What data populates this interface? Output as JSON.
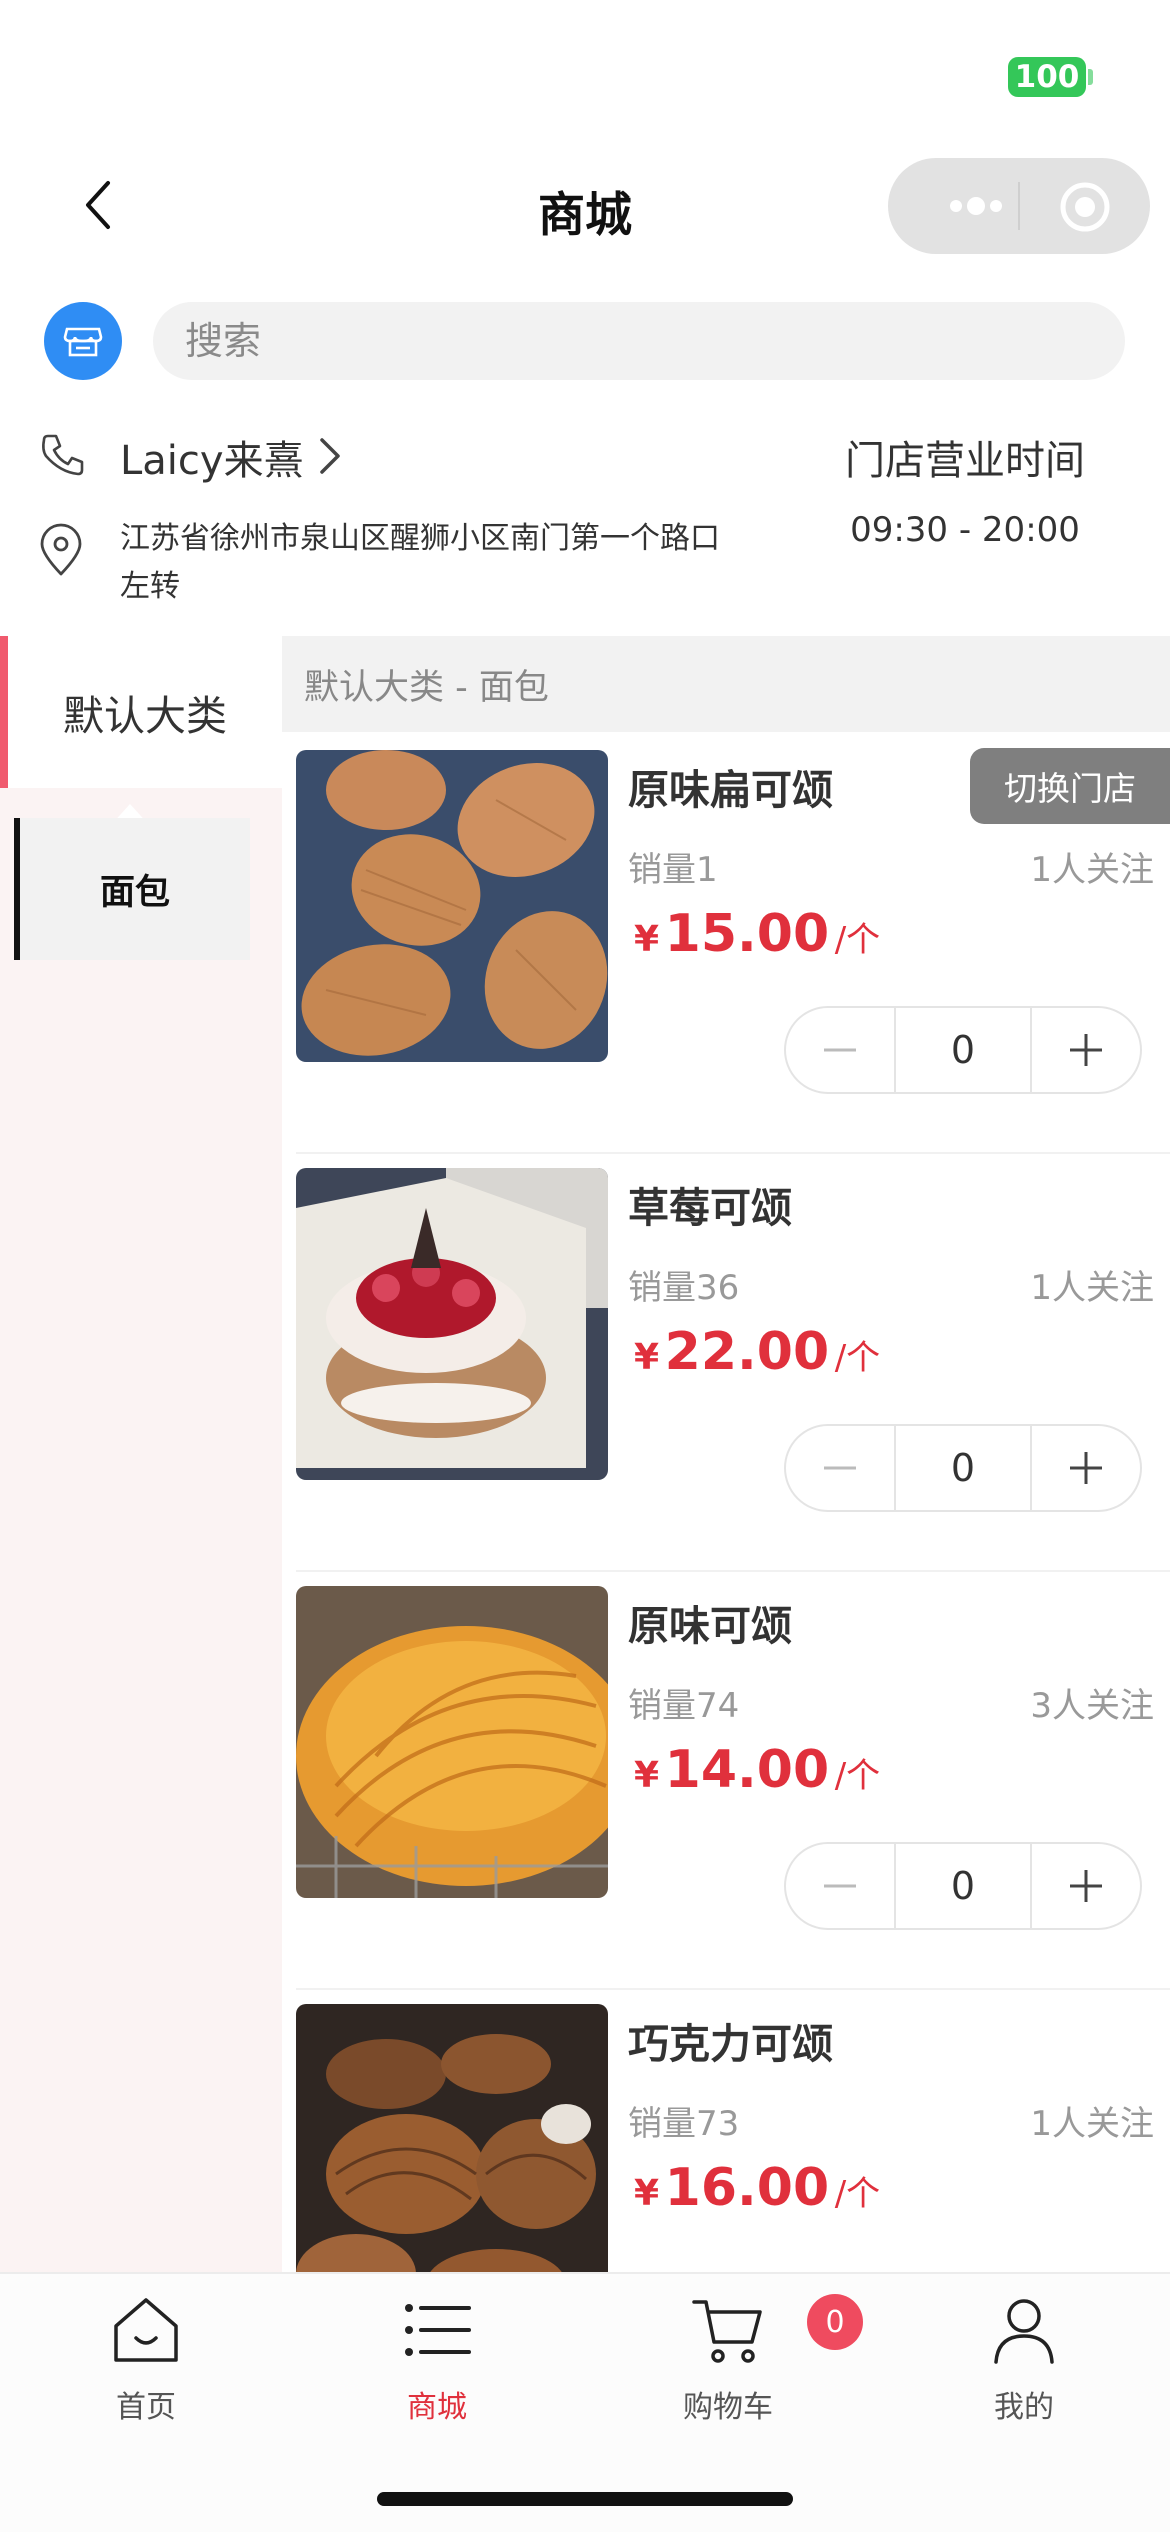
{
  "status": {
    "battery": "100"
  },
  "nav": {
    "title": "商城"
  },
  "search": {
    "placeholder": "搜索"
  },
  "store": {
    "name": "Laicy来熹",
    "hours_label": "门店营业时间",
    "hours": "09:30 - 20:00",
    "address": "江苏省徐州市泉山区醒狮小区南门第一个路口左转"
  },
  "categories": {
    "main": "默认大类",
    "sub": "面包"
  },
  "list": {
    "header": "默认大类 - 面包",
    "switch_store": "切换门店",
    "currency": "¥",
    "unit": "/个",
    "products": [
      {
        "name": "原味扁可颂",
        "sales": "销量1",
        "follow": "1人关注",
        "price": "15.00",
        "qty": "0"
      },
      {
        "name": "草莓可颂",
        "sales": "销量36",
        "follow": "1人关注",
        "price": "22.00",
        "qty": "0"
      },
      {
        "name": "原味可颂",
        "sales": "销量74",
        "follow": "3人关注",
        "price": "14.00",
        "qty": "0"
      },
      {
        "name": "巧克力可颂",
        "sales": "销量73",
        "follow": "1人关注",
        "price": "16.00"
      }
    ]
  },
  "tabs": [
    {
      "label": "首页",
      "icon": "home-icon"
    },
    {
      "label": "商城",
      "icon": "list-icon"
    },
    {
      "label": "购物车",
      "icon": "cart-icon"
    },
    {
      "label": "我的",
      "icon": "user-icon"
    }
  ],
  "cart_badge": "0",
  "colors": {
    "accent": "#e0303c",
    "badge": "#ef4b5f",
    "shop_icon": "#2f8df4",
    "category_marker": "#f05a6e"
  }
}
